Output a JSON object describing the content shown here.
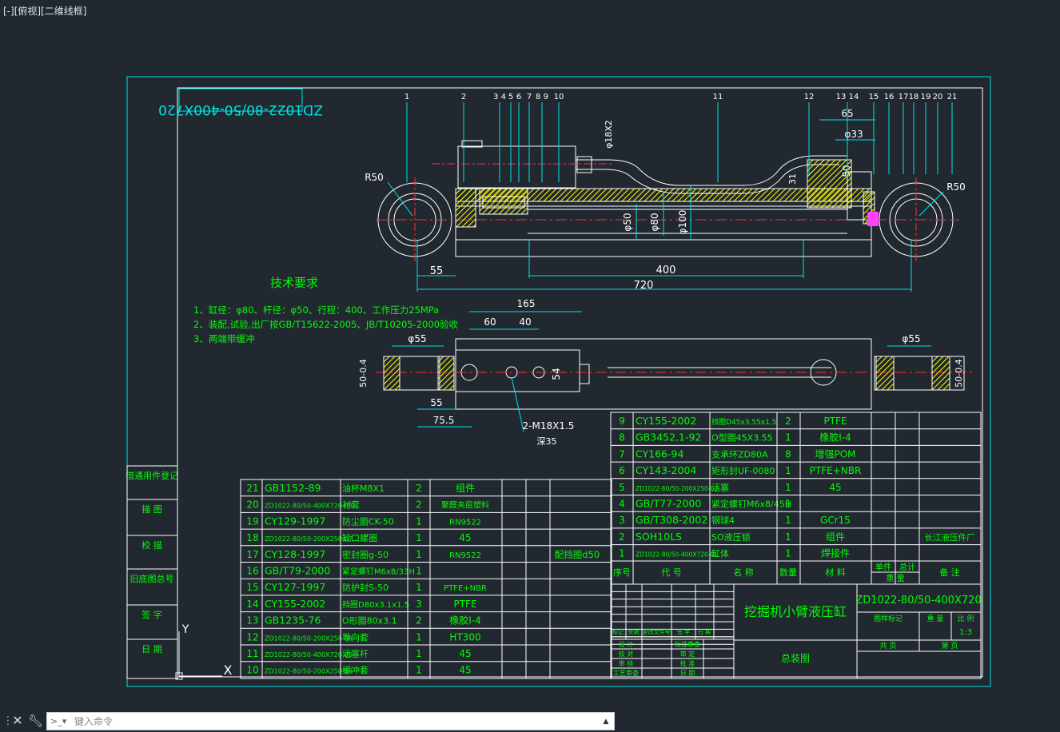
{
  "viewport": {
    "label": "[-][俯视][二维线框]"
  },
  "command_line": {
    "placeholder": "键入命令"
  },
  "drawing": {
    "drawing_number_top": "ZD1022-80/50-400X720",
    "tech_req": {
      "title": "技术要求",
      "lines": [
        "1、缸径：φ80、杆径：φ50、行程：400、工作压力25MPa",
        "2、装配,试验,出厂按GB/T15622-2005、JB/T10205-2000验收",
        "3、两端带缓冲"
      ]
    },
    "part_callouts": [
      "1",
      "2",
      "3 4",
      "5",
      "6",
      "7",
      "8 9",
      "10",
      "11",
      "12",
      "13 14",
      "15",
      "16",
      "17",
      "18",
      "19",
      "20",
      "21"
    ],
    "dimensions_top": {
      "r_left": "R50",
      "r_right": "R50",
      "d18x2": "φ18X2",
      "len_55": "55",
      "len_400": "400",
      "len_720": "720",
      "d50": "φ50",
      "d80": "φ80",
      "d100": "φ100",
      "len_65": "65",
      "d33": "φ33",
      "len_50": "50",
      "len_31": "31"
    },
    "dimensions_bottom": {
      "d55_left": "φ55",
      "d55_right": "φ55",
      "len_165": "165",
      "len_60": "60",
      "len_40": "40",
      "len_54": "54",
      "len_55": "55",
      "len_75_5": "75.5",
      "tol_left": "50-0.4",
      "tol_right": "50-0.4",
      "thread": "2-M18X1.5",
      "deep": "深35"
    },
    "left_strip": [
      "借通用件登记",
      "描 图",
      "校 描",
      "旧底图总号",
      "签 字",
      "日 期"
    ],
    "bom_left": [
      {
        "no": "21",
        "code": "GB1152-89",
        "name": "油杯M8X1",
        "qty": "2",
        "material": "组件",
        "note": ""
      },
      {
        "no": "20",
        "code": "ZD1022-80/50-400X720-08",
        "name": "衬套",
        "qty": "2",
        "material": "聚醛夹层塑料",
        "note": ""
      },
      {
        "no": "19",
        "code": "CY129-1997",
        "name": "防尘圈CK-50",
        "qty": "1",
        "material": "RN9522",
        "note": ""
      },
      {
        "no": "18",
        "code": "ZD1022-80/50-200X250-07",
        "name": "缸口螺圈",
        "qty": "1",
        "material": "45",
        "note": ""
      },
      {
        "no": "17",
        "code": "CY128-1997",
        "name": "密封圈g-50",
        "qty": "1",
        "material": "RN9522",
        "note": "配挡圈d50"
      },
      {
        "no": "16",
        "code": "GB/T79-2000",
        "name": "紧定螺钉M6x8/33H",
        "qty": "1",
        "material": "",
        "note": ""
      },
      {
        "no": "15",
        "code": "CY127-1997",
        "name": "防护封S-50",
        "qty": "1",
        "material": "PTFE+NBR",
        "note": ""
      },
      {
        "no": "14",
        "code": "CY155-2002",
        "name": "挡圈D80x3.1x1.5",
        "qty": "3",
        "material": "PTFE",
        "note": ""
      },
      {
        "no": "13",
        "code": "GB1235-76",
        "name": "O形圈80x3.1",
        "qty": "2",
        "material": "橡胶I-4",
        "note": ""
      },
      {
        "no": "12",
        "code": "ZD1022-80/50-200X250-06",
        "name": "导向套",
        "qty": "1",
        "material": "HT300",
        "note": ""
      },
      {
        "no": "11",
        "code": "ZD1022-80/50-400X720-05",
        "name": "活塞杆",
        "qty": "1",
        "material": "45",
        "note": ""
      },
      {
        "no": "10",
        "code": "ZD1022-80/50-200X250-04",
        "name": "缓冲套",
        "qty": "1",
        "material": "45",
        "note": ""
      }
    ],
    "bom_right": [
      {
        "no": "9",
        "code": "CY155-2002",
        "name": "挡圈D45x3.55x1.5",
        "qty": "2",
        "material": "PTFE",
        "note": ""
      },
      {
        "no": "8",
        "code": "GB3452.1-92",
        "name": "O型圈45X3.55",
        "qty": "1",
        "material": "橡胶I-4",
        "note": ""
      },
      {
        "no": "7",
        "code": "CY166-94",
        "name": "支承环ZD80A",
        "qty": "8",
        "material": "增强POM",
        "note": ""
      },
      {
        "no": "6",
        "code": "CY143-2004",
        "name": "矩形封UF-0080",
        "qty": "1",
        "material": "PTFE+NBR",
        "note": ""
      },
      {
        "no": "5",
        "code": "ZD1022-80/50-200X250-03",
        "name": "活塞",
        "qty": "1",
        "material": "45",
        "note": ""
      },
      {
        "no": "4",
        "code": "GB/T77-2000",
        "name": "紧定螺钉M6x8/45H",
        "qty": "1",
        "material": "",
        "note": ""
      },
      {
        "no": "3",
        "code": "GB/T308-2002",
        "name": "钢球4",
        "qty": "1",
        "material": "GCr15",
        "note": ""
      },
      {
        "no": "2",
        "code": "SOH10LS",
        "name": "SO液压锁",
        "qty": "1",
        "material": "组件",
        "note": "长江液压件厂"
      },
      {
        "no": "1",
        "code": "ZD1022-80/50-400X720-01",
        "name": "缸体",
        "qty": "1",
        "material": "焊接件",
        "note": ""
      }
    ],
    "bom_header": {
      "no": "序号",
      "code": "代 号",
      "name": "名 称",
      "qty": "数量",
      "material": "材 料",
      "unit": "单件",
      "total": "总计",
      "weight": "重 量",
      "note": "备 注"
    },
    "title_block": {
      "name": "挖掘机小臂液压缸",
      "drawing_no": "ZD1022-80/50-400X720",
      "assembly": "总装图",
      "stage": "图样标记",
      "weight": "重 量",
      "scale_label": "比 例",
      "scale": "1:3",
      "sheet_total": "共 页",
      "sheet": "第 页",
      "rows": [
        "设 计",
        "校 对",
        "审 核",
        "工艺审查"
      ],
      "rows2": [
        "标准审查",
        "审 定",
        "批 准",
        "日 期"
      ],
      "small_hdr": [
        "标记",
        "处数",
        "更改文件号",
        "签 字",
        "日 期"
      ]
    },
    "ucs": {
      "y": "Y",
      "x": "X"
    }
  }
}
